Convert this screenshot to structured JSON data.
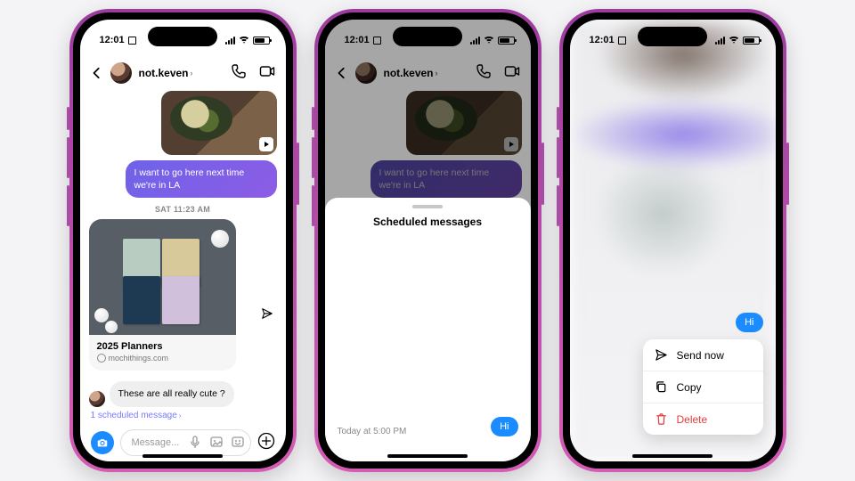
{
  "status": {
    "time": "12:01"
  },
  "chat": {
    "username": "not.keven",
    "outgoing_text": "I want to go here next time we're in LA",
    "timestamp": "SAT 11:23 AM",
    "card_title": "2025 Planners",
    "card_url": "mochithings.com",
    "incoming_text": "These are all really cute ?",
    "scheduled_link": "1 scheduled message",
    "composer_placeholder": "Message..."
  },
  "sheet": {
    "title": "Scheduled messages",
    "time_label": "Today at 5:00 PM",
    "bubble_text": "Hi"
  },
  "context_menu": {
    "bubble_text": "Hi",
    "send_now": "Send now",
    "copy": "Copy",
    "delete": "Delete"
  }
}
